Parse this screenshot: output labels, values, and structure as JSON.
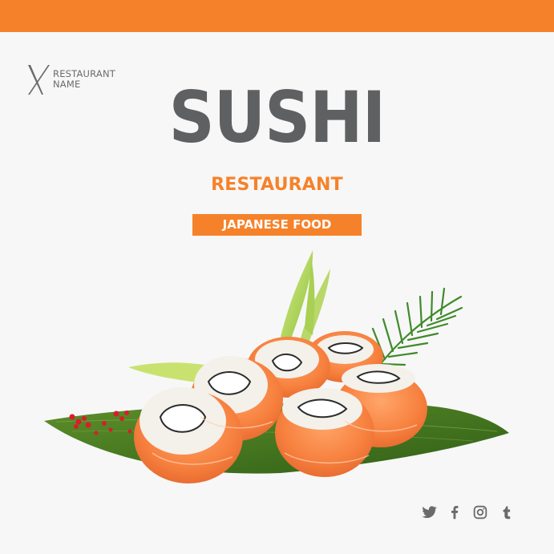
{
  "brand": {
    "logo_line1": "RESTAURANT",
    "logo_line2": "NAME"
  },
  "hero": {
    "title": "SUSHI",
    "subtitle": "RESTAURANT",
    "badge": "JAPANESE FOOD"
  },
  "colors": {
    "accent": "#f5822a",
    "title_gray": "#5f6062",
    "background": "#f7f7f7"
  },
  "social": [
    {
      "icon": "twitter-icon"
    },
    {
      "icon": "facebook-icon"
    },
    {
      "icon": "instagram-icon"
    },
    {
      "icon": "tumblr-icon"
    }
  ]
}
